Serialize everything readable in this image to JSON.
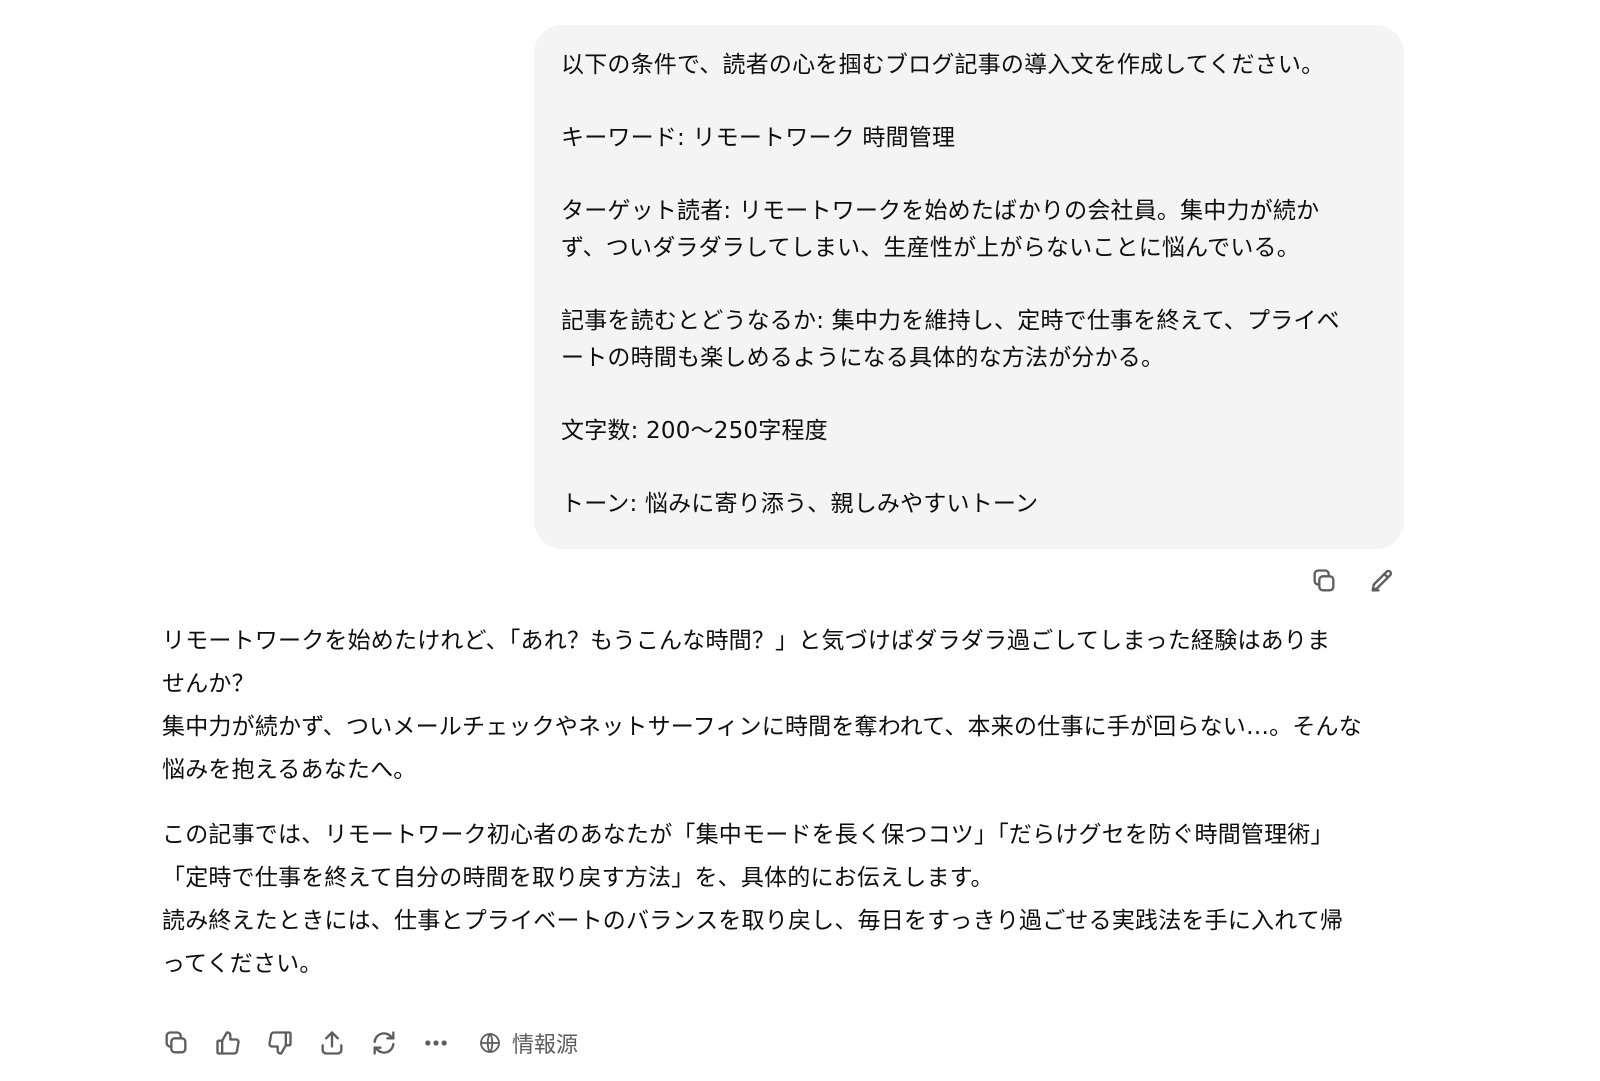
{
  "user_message": {
    "paragraphs": [
      [
        "以下の条件で、読者の心を掴むブログ記事の導入文を作成してください。"
      ],
      [
        "キーワード: リモートワーク 時間管理"
      ],
      [
        "ターゲット読者: リモートワークを始めたばかりの会社員。集中力が続か",
        "ず、ついダラダラしてしまい、生産性が上がらないことに悩んでいる。"
      ],
      [
        "記事を読むとどうなるか: 集中力を維持し、定時で仕事を終えて、プライベ",
        "ートの時間も楽しめるようになる具体的な方法が分かる。"
      ],
      [
        "文字数: 200～250字程度"
      ],
      [
        "トーン: 悩みに寄り添う、親しみやすいトーン"
      ]
    ],
    "actions": [
      {
        "name": "copy-button",
        "icon": "copy-icon"
      },
      {
        "name": "edit-button",
        "icon": "pencil-icon"
      }
    ]
  },
  "assistant_message": {
    "paragraphs": [
      [
        "リモートワークを始めたけれど、「あれ？もうこんな時間？」と気づけばダラダラ過ごしてしまった経験はありま",
        "せんか？",
        "集中力が続かず、ついメールチェックやネットサーフィンに時間を奪われて、本来の仕事に手が回らない…。そんな",
        "悩みを抱えるあなたへ。"
      ],
      [
        "この記事では、リモートワーク初心者のあなたが「集中モードを長く保つコツ」「だらけグセを防ぐ時間管理術」",
        "「定時で仕事を終えて自分の時間を取り戻す方法」を、具体的にお伝えします。",
        "読み終えたときには、仕事とプライベートのバランスを取り戻し、毎日をすっきり過ごせる実践法を手に入れて帰",
        "ってください。"
      ]
    ],
    "actions": [
      {
        "name": "copy-button",
        "icon": "copy-icon"
      },
      {
        "name": "thumbs-up-button",
        "icon": "thumbs-up-icon"
      },
      {
        "name": "thumbs-down-button",
        "icon": "thumbs-down-icon"
      },
      {
        "name": "share-button",
        "icon": "share-icon"
      },
      {
        "name": "regenerate-button",
        "icon": "refresh-icon"
      },
      {
        "name": "more-button",
        "icon": "ellipsis-icon"
      }
    ],
    "sources_label": "情報源"
  },
  "colors": {
    "user_bubble_bg": "#f4f4f4",
    "icon": "#5d5d5d",
    "text": "#0d0d0d"
  }
}
